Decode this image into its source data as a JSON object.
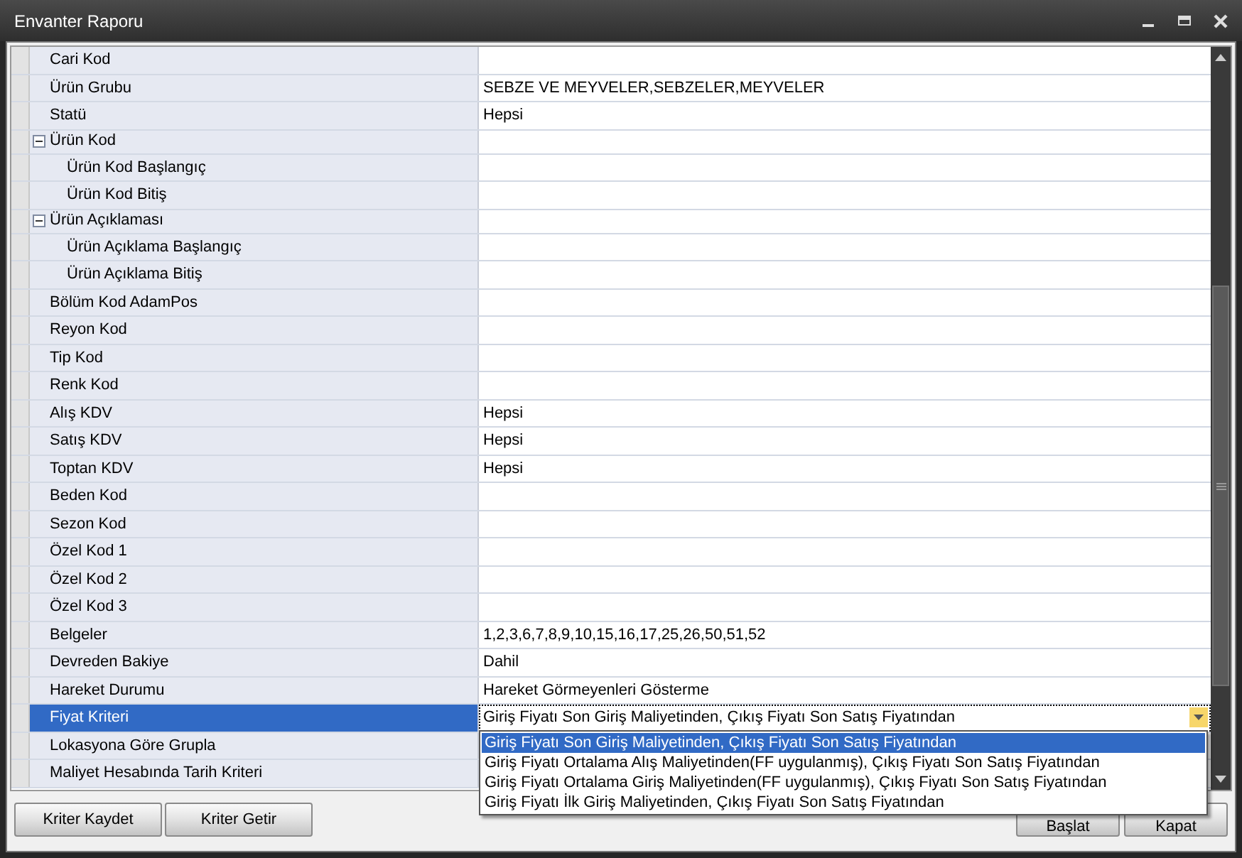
{
  "window": {
    "title": "Envanter Raporu"
  },
  "properties": [
    {
      "label": "Cari Kod",
      "selected": false
    },
    {
      "label": "Ürün Grubu",
      "value": "SEBZE VE MEYVELER,SEBZELER,MEYVELER",
      "selected": false
    },
    {
      "label": "Statü",
      "value": "Hepsi",
      "selected": false
    },
    {
      "label": "Ürün Kod",
      "expanded": true,
      "selected": false,
      "children": [
        {
          "label": "Ürün Kod Başlangıç",
          "selected": false
        },
        {
          "label": "Ürün Kod Bitiş",
          "selected": false
        }
      ]
    },
    {
      "label": "Ürün Açıklaması",
      "expanded": true,
      "selected": false,
      "children": [
        {
          "label": "Ürün Açıklama Başlangıç",
          "selected": false
        },
        {
          "label": "Ürün Açıklama Bitiş",
          "selected": false
        }
      ]
    },
    {
      "label": "Bölüm Kod AdamPos",
      "selected": false
    },
    {
      "label": "Reyon Kod",
      "selected": false
    },
    {
      "label": "Tip Kod",
      "selected": false
    },
    {
      "label": "Renk Kod",
      "selected": false
    },
    {
      "label": "Alış KDV",
      "value": "Hepsi",
      "selected": false
    },
    {
      "label": "Satış KDV",
      "value": "Hepsi",
      "selected": false
    },
    {
      "label": "Toptan KDV",
      "value": "Hepsi",
      "selected": false
    },
    {
      "label": "Beden Kod",
      "selected": false
    },
    {
      "label": "Sezon Kod",
      "selected": false
    },
    {
      "label": "Özel Kod 1",
      "selected": false
    },
    {
      "label": "Özel Kod 2",
      "selected": false
    },
    {
      "label": "Özel Kod 3",
      "selected": false
    },
    {
      "label": "Belgeler",
      "value": "1,2,3,6,7,8,9,10,15,16,17,25,26,50,51,52",
      "selected": false
    },
    {
      "label": "Devreden Bakiye",
      "value": "Dahil",
      "selected": false
    },
    {
      "label": "Hareket Durumu",
      "value": "Hareket Görmeyenleri Gösterme",
      "selected": false
    },
    {
      "label": "Fiyat Kriteri",
      "value": "Giriş Fiyatı Son Giriş Maliyetinden, Çıkış Fiyatı Son Satış Fiyatından",
      "selected": true
    },
    {
      "label": "Lokasyona Göre Grupla",
      "selected": false
    },
    {
      "label": "Maliyet Hesabında Tarih Kriteri",
      "selected": false
    }
  ],
  "dropdown_options": [
    {
      "label": "Giriş Fiyatı Son Giriş Maliyetinden, Çıkış Fiyatı Son Satış Fiyatından",
      "selected": true
    },
    {
      "label": "Giriş Fiyatı Ortalama Alış Maliyetinden(FF uygulanmış), Çıkış Fiyatı Son Satış Fiyatından",
      "selected": false
    },
    {
      "label": "Giriş Fiyatı Ortalama Giriş Maliyetinden(FF uygulanmış), Çıkış Fiyatı Son Satış Fiyatından",
      "selected": false
    },
    {
      "label": "Giriş Fiyatı İlk Giriş Maliyetinden, Çıkış Fiyatı Son Satış Fiyatından",
      "selected": false
    }
  ],
  "buttons_left": [
    "Kriter Kaydet",
    "Kriter Getir"
  ],
  "buttons_right": [
    "Başlat",
    "Kapat"
  ]
}
